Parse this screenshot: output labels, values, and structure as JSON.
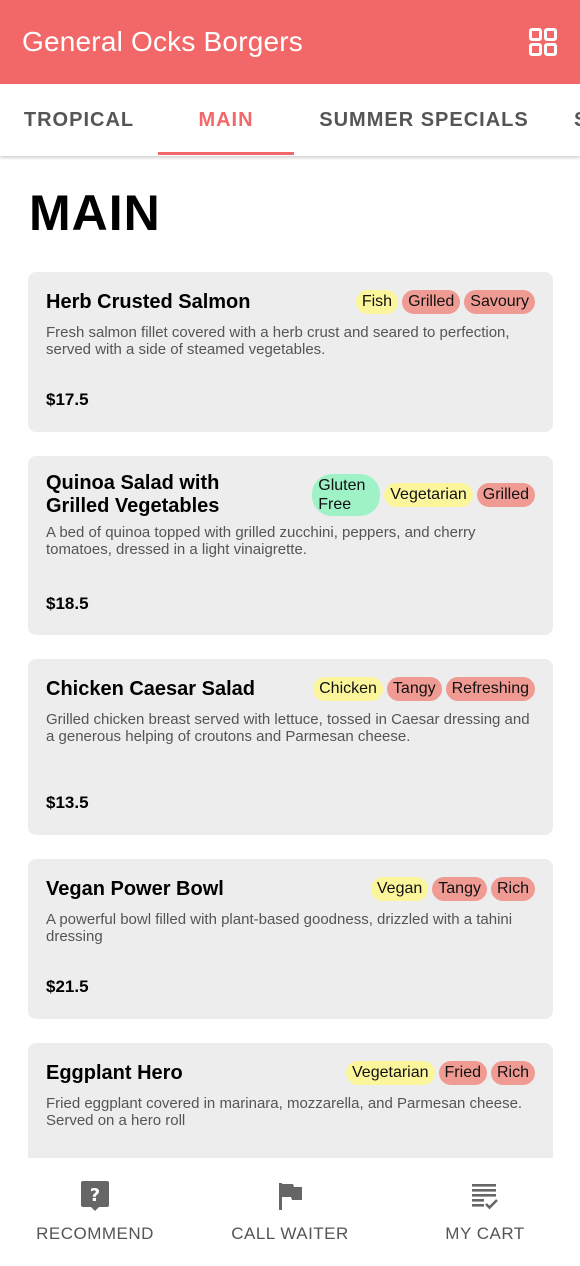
{
  "app": {
    "title": "General Ocks Borgers",
    "header_icon": "grid-icon"
  },
  "tabs": [
    {
      "label": "TROPICAL",
      "active": false
    },
    {
      "label": "MAIN",
      "active": true
    },
    {
      "label": "SUMMER SPECIALS",
      "active": false
    },
    {
      "label": "S",
      "active": false
    }
  ],
  "section": {
    "title": "MAIN"
  },
  "colors": {
    "accent": "#f26868",
    "card_bg": "#ededed",
    "tag_yellow": "#fbf59c",
    "tag_red": "#ef9b93",
    "tag_green": "#9ef2c6"
  },
  "items": [
    {
      "name": "Herb Crusted Salmon",
      "tags": [
        {
          "label": "Fish",
          "color": "yellow"
        },
        {
          "label": "Grilled",
          "color": "red"
        },
        {
          "label": "Savoury",
          "color": "red"
        }
      ],
      "description": "Fresh salmon fillet covered with a herb crust and seared to perfection, served with a side of steamed vegetables.",
      "price": "$17.5"
    },
    {
      "name": "Quinoa Salad with Grilled Vegetables",
      "tags": [
        {
          "label": "Gluten Free",
          "color": "green"
        },
        {
          "label": "Vegetarian",
          "color": "yellow"
        },
        {
          "label": "Grilled",
          "color": "red"
        }
      ],
      "description": "A bed of quinoa topped with grilled zucchini, peppers, and cherry tomatoes, dressed in a light vinaigrette.",
      "price": "$18.5"
    },
    {
      "name": "Chicken Caesar Salad",
      "tags": [
        {
          "label": "Chicken",
          "color": "yellow"
        },
        {
          "label": "Tangy",
          "color": "red"
        },
        {
          "label": "Refreshing",
          "color": "red"
        }
      ],
      "description": "Grilled chicken breast served with lettuce, tossed in Caesar dressing and a generous helping of croutons and Parmesan cheese.",
      "price": "$13.5"
    },
    {
      "name": "Vegan Power Bowl",
      "tags": [
        {
          "label": "Vegan",
          "color": "yellow"
        },
        {
          "label": "Tangy",
          "color": "red"
        },
        {
          "label": "Rich",
          "color": "red"
        }
      ],
      "description": "A powerful bowl filled with plant-based goodness, drizzled with a tahini dressing",
      "price": "$21.5"
    },
    {
      "name": "Eggplant Hero",
      "tags": [
        {
          "label": "Vegetarian",
          "color": "yellow"
        },
        {
          "label": "Fried",
          "color": "red"
        },
        {
          "label": "Rich",
          "color": "red"
        }
      ],
      "description": "Fried eggplant covered in marinara, mozzarella, and Parmesan cheese. Served on a hero roll",
      "price": ""
    }
  ],
  "bottom_nav": [
    {
      "label": "RECOMMEND",
      "icon": "question-icon"
    },
    {
      "label": "CALL WAITER",
      "icon": "flag-icon"
    },
    {
      "label": "MY CART",
      "icon": "cart-list-icon"
    }
  ]
}
